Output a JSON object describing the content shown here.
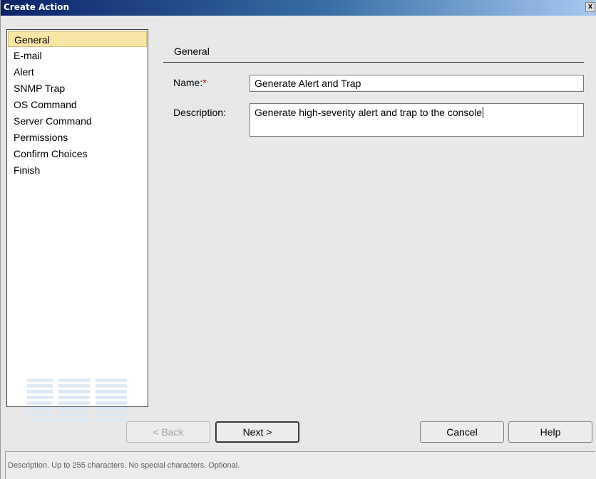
{
  "window": {
    "title": "Create Action",
    "close_label": "x"
  },
  "nav": {
    "items": [
      {
        "label": "General",
        "selected": true
      },
      {
        "label": "E-mail"
      },
      {
        "label": "Alert"
      },
      {
        "label": "SNMP Trap"
      },
      {
        "label": "OS Command"
      },
      {
        "label": "Server Command"
      },
      {
        "label": "Permissions"
      },
      {
        "label": "Confirm Choices"
      },
      {
        "label": "Finish"
      }
    ],
    "logo": "IBM"
  },
  "form": {
    "section_title": "General",
    "name_label": "Name:",
    "required_marker": "*",
    "name_value": "Generate Alert and Trap",
    "description_label": "Description:",
    "description_value": "Generate high-severity alert and trap to the console"
  },
  "buttons": {
    "back": "< Back",
    "next": "Next >",
    "cancel": "Cancel",
    "help": "Help"
  },
  "status": {
    "text": "Description. Up to 255 characters. No special characters. Optional."
  },
  "colors": {
    "selection": "#f8e6a8",
    "title_bar": "#0a246a",
    "required": "#cc0000"
  }
}
